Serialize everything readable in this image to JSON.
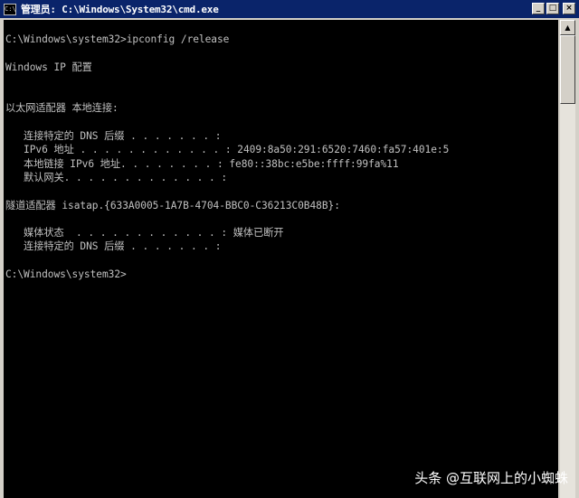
{
  "window": {
    "title": "管理员: C:\\Windows\\System32\\cmd.exe",
    "icon": "cmd-window-icon",
    "buttons": {
      "minimize": "_",
      "maximize": "□",
      "close": "×"
    }
  },
  "console": {
    "text": "C:\\Windows\\system32>ipconfig /release\n\nWindows IP 配置\n\n\n以太网适配器 本地连接:\n\n   连接特定的 DNS 后缀 . . . . . . . :\n   IPv6 地址 . . . . . . . . . . . . : 2409:8a50:291:6520:7460:fa57:401e:5\n   本地链接 IPv6 地址. . . . . . . . : fe80::38bc:e5be:ffff:99fa%11\n   默认网关. . . . . . . . . . . . . :\n\n隧道适配器 isatap.{633A0005-1A7B-4704-BBC0-C36213C0B48B}:\n\n   媒体状态  . . . . . . . . . . . . : 媒体已断开\n   连接特定的 DNS 后缀 . . . . . . . :\n\nC:\\Windows\\system32>"
  },
  "scrollbar": {
    "up_arrow": "▲"
  },
  "watermark": {
    "text": "头条 @互联网上的小蜘蛛"
  }
}
